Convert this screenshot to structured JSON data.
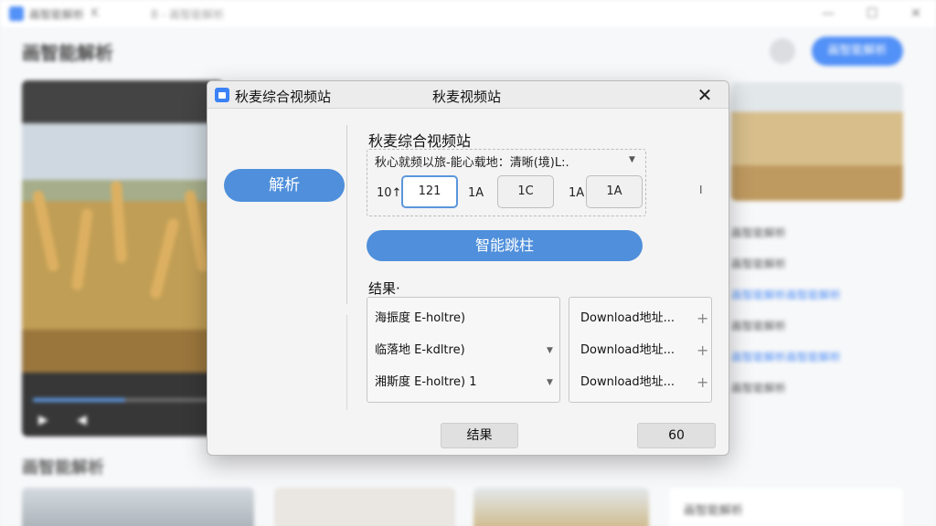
{
  "background": {
    "app_title": "画智能解析",
    "tab_label": "K",
    "url": "B - 画智能解析",
    "header_title": "画智能解析",
    "header_button": "画智能解析",
    "player_progress": 0.48,
    "section_title": "画智能解析",
    "list_items": [
      {
        "text": "画智能解析",
        "link": false
      },
      {
        "text": "画智能解析",
        "link": false
      },
      {
        "text": "画智能解析画智能解析",
        "link": true
      },
      {
        "text": "画智能解析",
        "link": false
      },
      {
        "text": "画智能解析画智能解析",
        "link": true
      },
      {
        "text": "画智能解析",
        "link": false
      }
    ],
    "side_card_title": "画智能解析",
    "win_minimize": "—",
    "win_maximize": "☐",
    "win_close": "✕",
    "play_icon": "▶",
    "volume_icon": "◀"
  },
  "dialog": {
    "app_name": "秋麦综合视频站",
    "title": "秋麦视频站",
    "close_label": "✕",
    "parse_button": "解析",
    "panel_title": "秋麦综合视频站",
    "quality_label": "秋心就频以旅-能心载地：清晰(境)L:.",
    "quality_caret": "▼",
    "quality_items": [
      {
        "type": "text",
        "value": "10↑"
      },
      {
        "type": "field",
        "value": "121",
        "active": true
      },
      {
        "type": "text",
        "value": "1A"
      },
      {
        "type": "field",
        "value": "1C",
        "active": false
      },
      {
        "type": "text",
        "value": "1A"
      },
      {
        "type": "field",
        "value": "1A",
        "active": false
      }
    ],
    "side_mark": "I",
    "smart_button": "智能跳柱",
    "result_label": "结果·",
    "result_rows": [
      {
        "text": "海振度 E-holtre)",
        "has_caret": false
      },
      {
        "text": "临落地 E-kdltre)",
        "has_caret": true
      },
      {
        "text": "湘斯度 E-holtre) 1",
        "has_caret": true
      }
    ],
    "download_rows": [
      {
        "text": "Download地址...",
        "plus": "+"
      },
      {
        "text": "Download地址...",
        "plus": "+"
      },
      {
        "text": "Download地址...",
        "plus": "+"
      }
    ],
    "footer_result_button": "结果",
    "footer_count_button": "60"
  }
}
